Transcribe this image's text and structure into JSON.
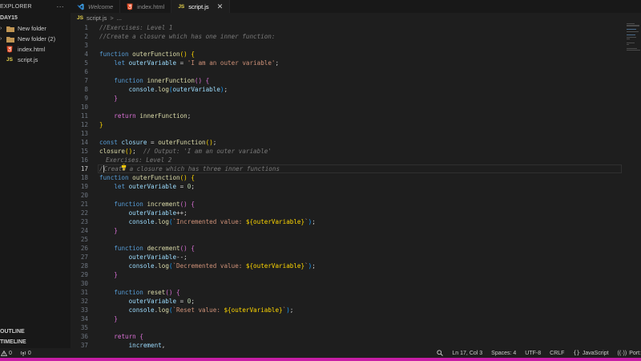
{
  "explorer": {
    "title": "EXPLORER",
    "more": "···",
    "root": "DAY15",
    "items": [
      {
        "label": "New folder",
        "type": "folder"
      },
      {
        "label": "New folder (2)",
        "type": "folder"
      },
      {
        "label": "index.html",
        "type": "html"
      },
      {
        "label": "script.js",
        "type": "js"
      }
    ],
    "outline": "OUTLINE",
    "timeline": "TIMELINE"
  },
  "tabs": [
    {
      "label": "Welcome",
      "icon": "vscode-icon"
    },
    {
      "label": "index.html",
      "icon": "html5-icon"
    },
    {
      "label": "script.js",
      "icon": "js-icon",
      "active": true,
      "close": "✕"
    }
  ],
  "breadcrumb": {
    "js_badge": "JS",
    "file": "script.js",
    "sep": ">",
    "rest": "..."
  },
  "editor": {
    "current_line": 17,
    "lines": [
      {
        "n": "1"
      },
      {
        "n": "2"
      },
      {
        "n": "3"
      },
      {
        "n": "4"
      },
      {
        "n": "5"
      },
      {
        "n": "6"
      },
      {
        "n": "7"
      },
      {
        "n": "8"
      },
      {
        "n": "9"
      },
      {
        "n": "10"
      },
      {
        "n": "11"
      },
      {
        "n": "12"
      },
      {
        "n": "13"
      },
      {
        "n": "14"
      },
      {
        "n": "15"
      },
      {
        "n": "16"
      },
      {
        "n": "17"
      },
      {
        "n": "18"
      },
      {
        "n": "19"
      },
      {
        "n": "20"
      },
      {
        "n": "21"
      },
      {
        "n": "22"
      },
      {
        "n": "23"
      },
      {
        "n": "24"
      },
      {
        "n": "25"
      },
      {
        "n": "26"
      },
      {
        "n": "27"
      },
      {
        "n": "28"
      },
      {
        "n": "29"
      },
      {
        "n": "30"
      },
      {
        "n": "31"
      },
      {
        "n": "32"
      },
      {
        "n": "33"
      },
      {
        "n": "34"
      },
      {
        "n": "35"
      },
      {
        "n": "36"
      },
      {
        "n": "37"
      }
    ],
    "code": {
      "l1": "//Exercises: Level 1",
      "l2": "//Create a closure which has one inner function:",
      "l4_kw": "function",
      "l4_fn": "outerFunction",
      "l5_kw": "let",
      "l5_var": "outerVariable",
      "l5_str": "'I am an outer variable'",
      "l7_kw": "function",
      "l7_fn": "innerFunction",
      "l8_obj": "console",
      "l8_fn": "log",
      "l8_var": "outerVariable",
      "l11_kw": "return",
      "l11_fn": "innerFunction",
      "l14_kw": "const",
      "l14_var": "closure",
      "l14_fn": "outerFunction",
      "l15_fn": "closure",
      "l15_cm": "// Output: 'I am an outer variable'",
      "l16": "Exercises: Level 2",
      "l17": "Create a closure which has three inner functions",
      "l18_kw": "function",
      "l18_fn": "outerFunction",
      "l19_kw": "let",
      "l19_var": "outerVariable",
      "l19_num": "0",
      "l21_kw": "function",
      "l21_fn": "increment",
      "l22_var": "outerVariable",
      "l23_obj": "console",
      "l23_fn": "log",
      "l23_str": "`Incremented value: ",
      "l23_tpl": "${outerVariable}",
      "l23_end": "`",
      "l26_kw": "function",
      "l26_fn": "decrement",
      "l27_var": "outerVariable",
      "l28_obj": "console",
      "l28_fn": "log",
      "l28_str": "`Decremented value: ",
      "l28_tpl": "${outerVariable}",
      "l28_end": "`",
      "l31_kw": "function",
      "l31_fn": "reset",
      "l32_var": "outerVariable",
      "l32_num": "0",
      "l33_obj": "console",
      "l33_fn": "log",
      "l33_str": "`Reset value: ",
      "l33_tpl": "${outerVariable}",
      "l33_end": "`",
      "l36_kw": "return",
      "l37_var": "increment"
    }
  },
  "status": {
    "errors": "0",
    "warnings": "0",
    "position": "Ln 17, Col 3",
    "spaces": "Spaces: 4",
    "encoding": "UTF-8",
    "eol": "CRLF",
    "language": "JavaScript",
    "port": "Port:"
  },
  "colors": {
    "accent": "#c71ea5",
    "keyword": "#569cd6",
    "function": "#dcdcaa",
    "variable": "#9cdcfe",
    "string": "#ce9178"
  }
}
